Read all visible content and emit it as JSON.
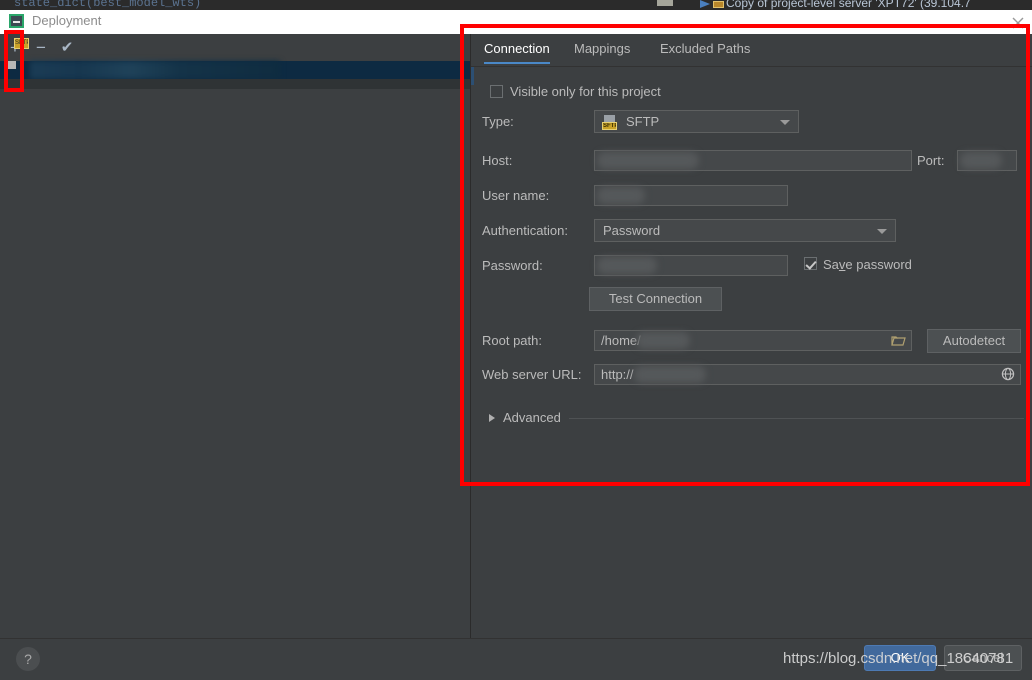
{
  "background": {
    "code_line": "state_dict(best_model_wts)",
    "tab_title": "Copy of project-level server 'XPT72' (39.104.7"
  },
  "window": {
    "title": "Deployment",
    "icon": "deployment-icon",
    "close_icon": "close-icon"
  },
  "left_panel": {
    "toolbar": {
      "add_label": "+",
      "remove_label": "−",
      "confirm_label": "✔",
      "add_name": "add-server-button",
      "remove_name": "remove-server-button",
      "confirm_name": "set-default-button"
    },
    "list": {
      "selected_item_badge": "SFTP"
    }
  },
  "dialog": {
    "tabs": [
      {
        "label": "Connection",
        "active": true
      },
      {
        "label": "Mappings",
        "active": false
      },
      {
        "label": "Excluded Paths",
        "active": false
      }
    ],
    "visible_only_checkbox": {
      "label": "Visible only for this project",
      "checked": false
    },
    "type": {
      "label": "Type:",
      "value": "SFTP",
      "icon_badge": "SFTP"
    },
    "host": {
      "label": "Host:",
      "value": "",
      "redacted": true
    },
    "port": {
      "label": "Port:",
      "value": "",
      "redacted": true
    },
    "user_name": {
      "label": "User name:",
      "value": "",
      "redacted": true
    },
    "authentication": {
      "label": "Authentication:",
      "value": "Password"
    },
    "password": {
      "label": "Password:",
      "value": "",
      "redacted": true
    },
    "save_password": {
      "label_before": "Sa",
      "label_mnemonic": "v",
      "label_after": "e password",
      "checked": true
    },
    "test_connection_button": "Test Connection",
    "root_path": {
      "label": "Root path:",
      "value": "/home/",
      "browse_icon": "folder-icon"
    },
    "autodetect_button": "Autodetect",
    "web_server_url": {
      "label": "Web server URL:",
      "value": "http://",
      "open_icon": "globe-icon"
    },
    "advanced": {
      "label": "Advanced",
      "expanded": false
    }
  },
  "footer": {
    "help_label": "?",
    "ok_label": "OK",
    "cancel_label": "Cancel",
    "watermark": "https://blog.csdn.net/qq_18640781"
  },
  "colors": {
    "dialog_bg": "#3c3f41",
    "field_bg": "#45484a",
    "text": "#bbbbbb",
    "accent_tab": "#4a88c7",
    "annotation_red": "#ff0000",
    "ok_button": "#41699c",
    "selection_blue": "#0d2a42"
  }
}
